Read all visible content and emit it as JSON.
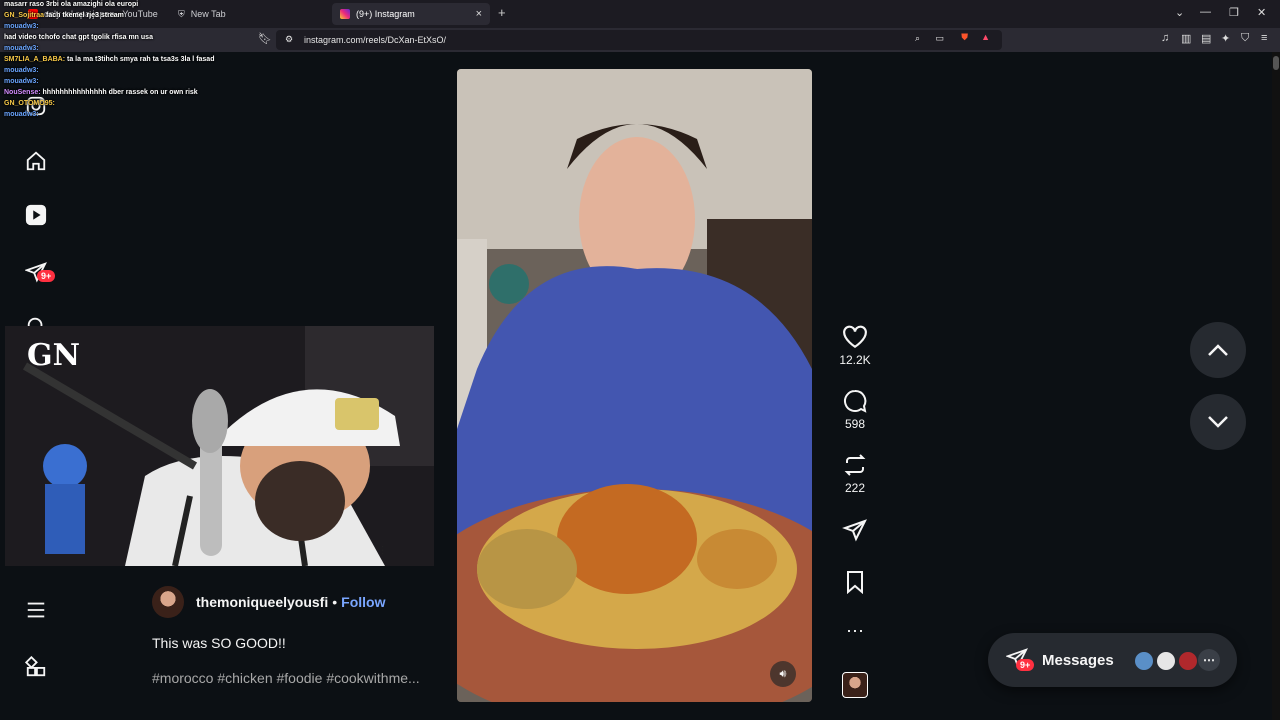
{
  "browser": {
    "tabs": [
      {
        "title": "only ral spa japan - YouTube",
        "active": false
      },
      {
        "title": "New Tab",
        "active": false
      },
      {
        "title": "(9+) Instagram",
        "active": true
      }
    ],
    "url": "instagram.com/reels/DcXan-EtXsO/"
  },
  "chat": {
    "lines": [
      {
        "user": "",
        "text": "masarr raso 3rbi ola amazighi ola europi"
      },
      {
        "user": "GN_Sojitraa",
        "text": "fach tkemel rje3 stream"
      },
      {
        "user": "mouadw3:",
        "text": ""
      },
      {
        "user": "",
        "text": "had video tchofo chat gpt tgolik rfisa mn usa"
      },
      {
        "user": "mouadw3:",
        "text": ""
      },
      {
        "user": "SM7LIA_A_BABA:",
        "text": "ta la ma t3tihch smya rah ta tsa3s 3la l fasad"
      },
      {
        "user": "mouadw3:",
        "text": ""
      },
      {
        "user": "mouadw3:",
        "text": ""
      },
      {
        "user": "NouSense:",
        "text": "hhhhhhhhhhhhhhh dber rassek on ur own risk"
      },
      {
        "user": "GN_OTOMO95:",
        "text": ""
      },
      {
        "user": "mouadw3:",
        "text": ""
      }
    ]
  },
  "leftnav": {
    "notification_badge": "9+"
  },
  "post": {
    "username": "themoniqueelyousfi",
    "separator": "•",
    "follow_label": "Follow",
    "caption": "This was SO GOOD!!",
    "tags": "#morocco #chicken #foodie #cookwithme..."
  },
  "actions": {
    "likes": "12.2K",
    "comments": "598",
    "reposts": "222"
  },
  "messages": {
    "label": "Messages",
    "badge": "9+"
  },
  "colors": {
    "background": "#0c1014",
    "accent_link": "#7aa6ff",
    "badge_red": "#ff3040"
  }
}
